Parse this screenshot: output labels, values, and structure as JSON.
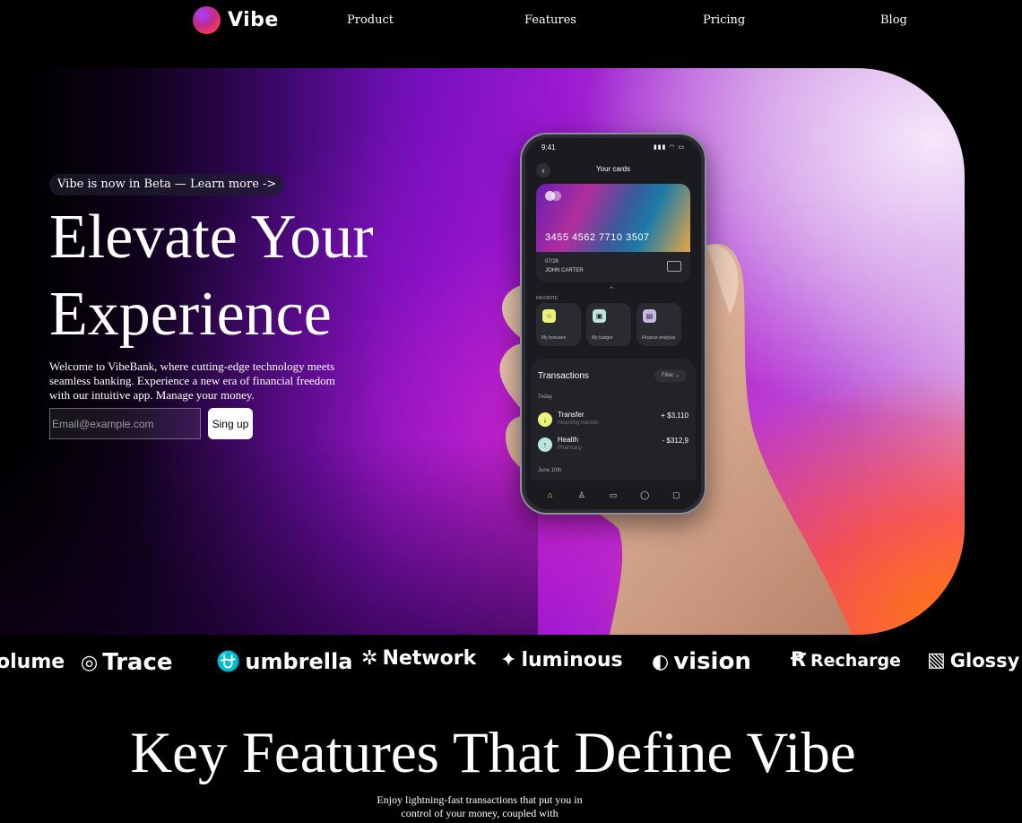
{
  "brand": {
    "name": "Vibe"
  },
  "nav": {
    "links": [
      "Product",
      "Features",
      "Pricing",
      "Blog"
    ]
  },
  "hero": {
    "beta_pill": "Vibe is now in Beta — Learn more ->",
    "headline": "Elevate Your Experience",
    "intro": "Welcome to VibeBank, where cutting-edge technology meets seamless banking. Experience a new era of financial freedom with our intuitive app. Manage your money.",
    "email_placeholder": "Email@example.com",
    "signup_label": "Sing up"
  },
  "phone": {
    "time": "9:41",
    "status_icons": "▮▮▮ ◠ ▭",
    "screen_title": "Your cards",
    "card": {
      "number": "3455 4562 7710 3507",
      "expiry": "07/26",
      "holder": "JOHN CARTER"
    },
    "favorites_label": "FAVORITE",
    "tiles": [
      {
        "label": "My bonuses",
        "color": "#eef27a",
        "icon": "star-icon"
      },
      {
        "label": "My budget",
        "color": "#bfe3e0",
        "icon": "wallet-icon"
      },
      {
        "label": "Finance analysis",
        "color": "#c9b6e4",
        "icon": "chart-icon"
      }
    ],
    "transactions": {
      "title": "Transactions",
      "filter": "Filter",
      "day": "Today",
      "items": [
        {
          "name": "Transfer",
          "sub": "Incoming transfer",
          "amount": "+ $3,110",
          "color": "#eef27a",
          "icon": "arrow-down-icon"
        },
        {
          "name": "Health",
          "sub": "Pharmacy",
          "amount": "- $312,9",
          "color": "#bfe3e0",
          "icon": "arrow-up-icon"
        }
      ],
      "day2": "June 10th"
    }
  },
  "logos": [
    {
      "text": "olume",
      "glyph": ""
    },
    {
      "text": "Trace",
      "glyph": "◎"
    },
    {
      "text": "umbrella",
      "glyph": "⛎"
    },
    {
      "text": "Network",
      "glyph": "✲"
    },
    {
      "text": "luminous",
      "glyph": "✦"
    },
    {
      "text": "vision",
      "glyph": "◐"
    },
    {
      "text": "Recharge",
      "glyph": "Ꞧ"
    },
    {
      "text": "Glossy",
      "glyph": "▧"
    }
  ],
  "features": {
    "title": "Key Features That Define Vibe",
    "subtitle": "Enjoy lightning-fast transactions that put you in control of your money, coupled with"
  }
}
